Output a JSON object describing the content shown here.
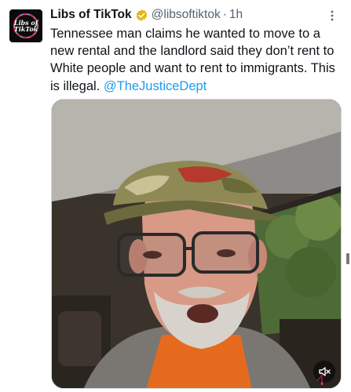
{
  "tweet": {
    "author": {
      "name": "Libs of TikTok",
      "handle": "@libsoftiktok",
      "avatar_text_line1": "Libs of",
      "avatar_text_line2": "TikTok",
      "verified_badge_color": "#e2b719"
    },
    "separator": "·",
    "time": "1h",
    "text_body": "Tennessee man claims he wanted to move to a new rental and the landlord said they don’t rent to White people and want to rent to immigrants. This is illegal. ",
    "mention": "@TheJusticeDept",
    "media": {
      "type": "video",
      "mute_icon": "speaker-muted-icon"
    }
  },
  "colors": {
    "text": "#0f1419",
    "secondary": "#536471",
    "link": "#1d9bf0",
    "border": "#cfd9de"
  }
}
